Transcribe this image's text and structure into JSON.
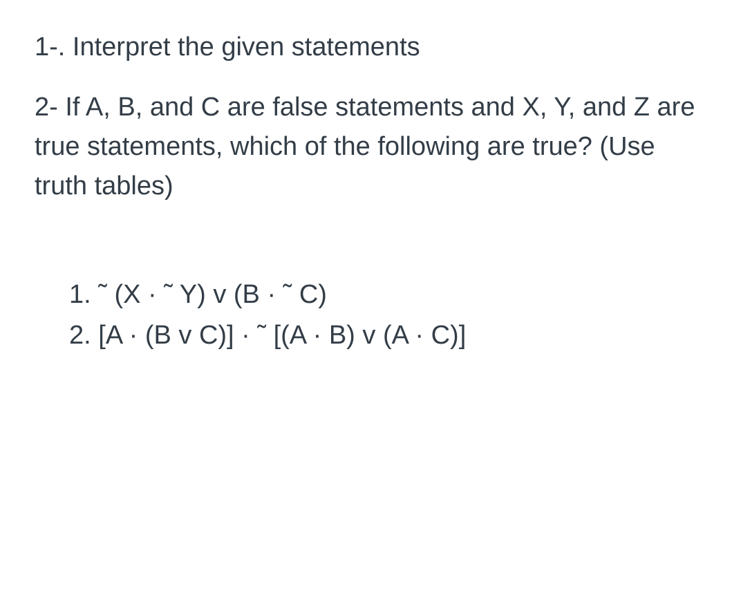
{
  "paragraphs": {
    "p1": "1-. Interpret the given statements",
    "p2": "2- If A, B, and C are false statements and X, Y, and Z are true statements, which of the following are true? (Use truth tables)"
  },
  "list": {
    "item1": {
      "number": "1.",
      "text": " ˜ (X · ˜ Y) v (B · ˜ C)"
    },
    "item2": {
      "number": "2.",
      "text": " [A · (B v C)] · ˜ [(A · B) v (A · C)]"
    }
  }
}
